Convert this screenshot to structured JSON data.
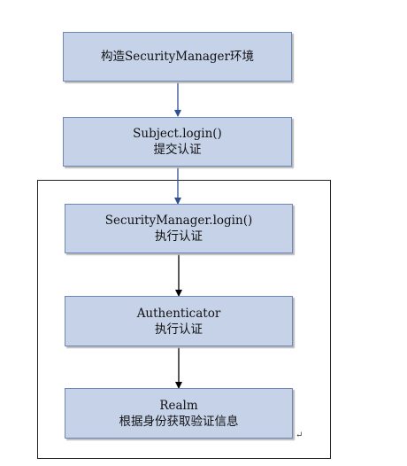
{
  "diagram": {
    "steps": [
      {
        "line1": "构造SecurityManager环境",
        "line2": ""
      },
      {
        "line1": "Subject.login()",
        "line2": "提交认证"
      },
      {
        "line1": "SecurityManager.login()",
        "line2": "执行认证"
      },
      {
        "line1": "Authenticator",
        "line2": "执行认证"
      },
      {
        "line1": "Realm",
        "line2": "根据身份获取验证信息"
      }
    ],
    "paragraph_mark": "↵"
  },
  "colors": {
    "box_fill": "#c5d2e8",
    "box_border": "#6d87b8",
    "blue_arrow": "#2e4f8f",
    "black_arrow": "#000000"
  }
}
